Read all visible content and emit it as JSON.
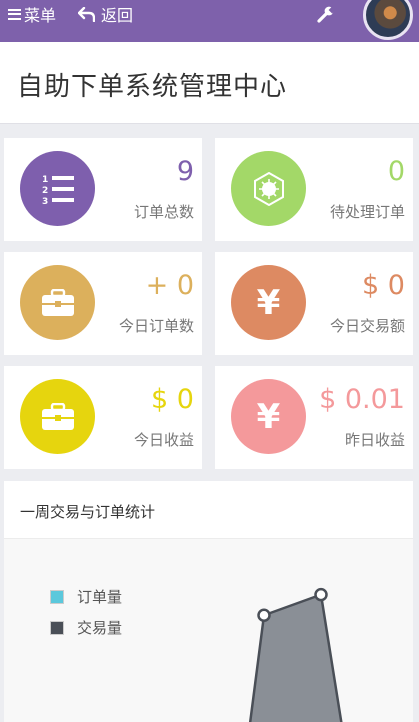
{
  "header": {
    "menu_label": "菜单",
    "back_label": "返回",
    "bg_color": "#7e61ab"
  },
  "page": {
    "title": "自助下单系统管理中心"
  },
  "stats": [
    {
      "value": "9",
      "label": "订单总数",
      "icon": "ordered-list-icon",
      "color": "#7e5fad",
      "value_color": "#7e5fad"
    },
    {
      "value": "0",
      "label": "待处理订单",
      "icon": "gear-badge-icon",
      "color": "#a3d868",
      "value_color": "#a3d868"
    },
    {
      "value": "+ 0",
      "label": "今日订单数",
      "icon": "briefcase-icon",
      "color": "#dcb05c",
      "value_color": "#dcb05c"
    },
    {
      "value": "$ 0",
      "label": "今日交易额",
      "icon": "yen-icon",
      "color": "#dd8a62",
      "value_color": "#dd8a62"
    },
    {
      "value": "$ 0",
      "label": "今日收益",
      "icon": "briefcase-icon",
      "color": "#e6d50e",
      "value_color": "#e6d50e"
    },
    {
      "value": "$ 0.01",
      "label": "昨日收益",
      "icon": "yen-icon",
      "color": "#f4999b",
      "value_color": "#f4999b"
    }
  ],
  "chart_panel": {
    "title": "一周交易与订单统计"
  },
  "chart_data": {
    "type": "area",
    "title": "",
    "series": [
      {
        "name": "订单量",
        "color": "#5bc8dc",
        "values": []
      },
      {
        "name": "交易量",
        "color": "#4a4f57",
        "fill": "#8a8f96",
        "values": [
          0,
          6,
          7,
          0
        ]
      }
    ],
    "legend": "top-left",
    "grid": false
  }
}
